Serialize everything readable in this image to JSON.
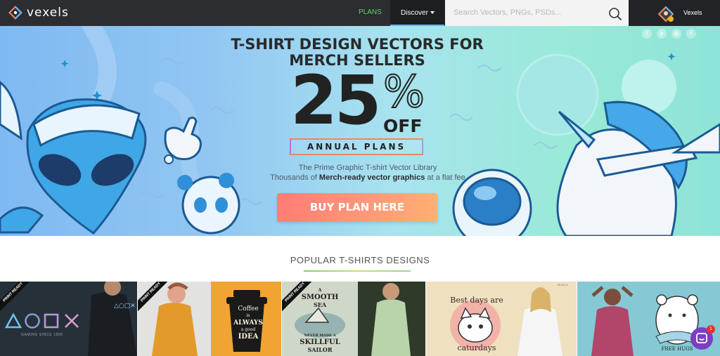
{
  "nav": {
    "brand": "vexels",
    "plans": "PLANS",
    "discover": "Discover",
    "search_placeholder": "Search Vectors, PNGs, PSDs...",
    "user_name": "Vexels"
  },
  "hero": {
    "headline_line1": "T-SHIRT DESIGN VECTORS FOR",
    "headline_line2": "MERCH SELLERS",
    "discount_number": "25",
    "discount_percent": "%",
    "discount_off": "OFF",
    "plan_badge": "ANNUAL PLANS",
    "subtitle_line1": "The Prime Graphic T-shirt Vector Library",
    "subtitle_line2_prefix": "Thousands of ",
    "subtitle_line2_bold": "Merch-ready vector graphics",
    "subtitle_line2_suffix": " at a flat fee",
    "cta": "BUY PLAN HERE",
    "social_icons": [
      "facebook-icon",
      "pinterest-icon",
      "instagram-icon",
      "twitter-icon"
    ]
  },
  "popular": {
    "title": "POPULAR T-SHIRTS DESIGNS"
  },
  "designs": [
    {
      "ribbon": "PRINT READY",
      "tagline": "GAMING SINCE 1995",
      "shapes": "△○□✕"
    },
    {
      "ribbon": "PRINT READY",
      "lines": [
        "Coffee",
        "is",
        "ALWAYS",
        "a good",
        "IDEA"
      ]
    },
    {
      "ribbon": "PRINT READY",
      "lines": [
        "A",
        "SMOOTH",
        "SEA",
        "NEVER MADE A",
        "SKILLFUL",
        "SAILOR"
      ]
    },
    {
      "lines": [
        "Best days are",
        "caturdays"
      ],
      "brand_mark": "VEXELS"
    },
    {
      "lines": [
        "FREE HUGS"
      ]
    }
  ],
  "colors": {
    "nav_bg": "#2b2d31",
    "plans_green": "#5fd36b",
    "cta_start": "#ff7c76",
    "cta_end": "#ffb073",
    "chat_purple": "#7b3fc3"
  },
  "chat": {
    "badge_count": "1"
  }
}
